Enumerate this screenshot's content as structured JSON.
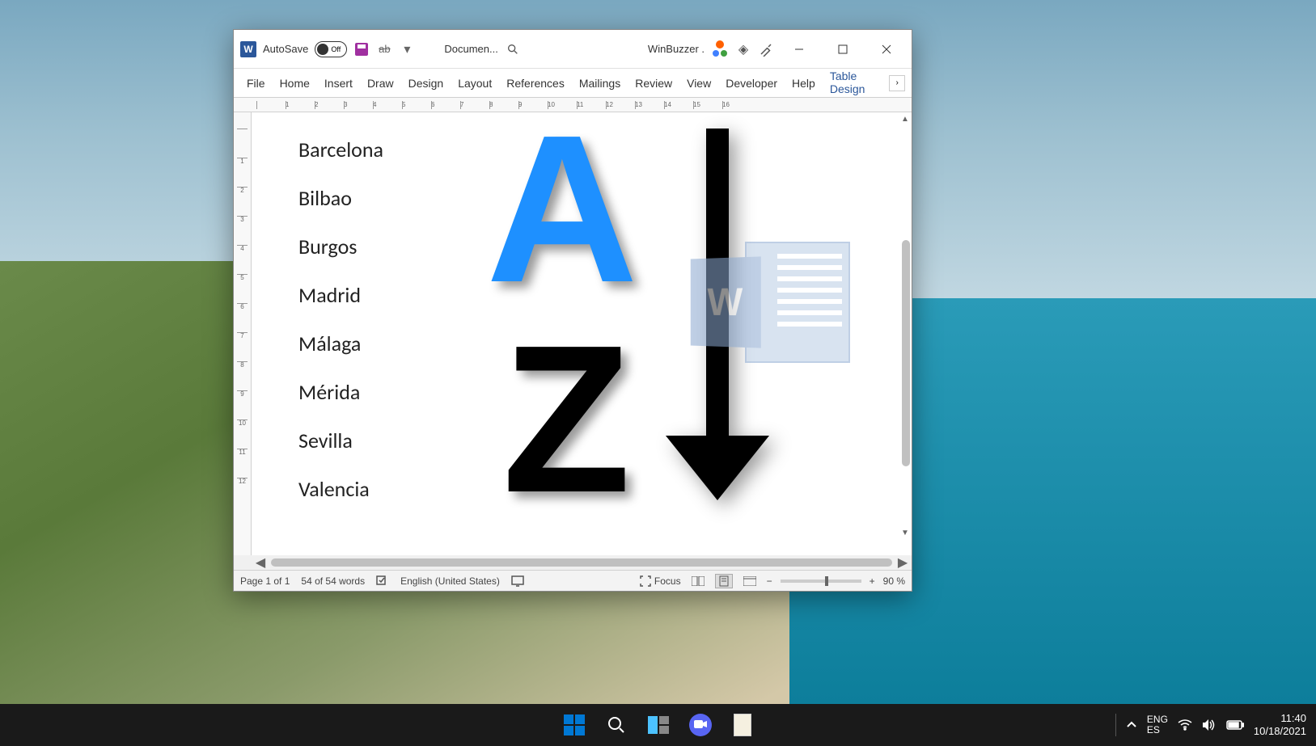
{
  "titlebar": {
    "autosave_label": "AutoSave",
    "autosave_state": "Off",
    "doc_title": "Documen...",
    "user_label": "WinBuzzer ."
  },
  "ribbon": {
    "tabs": [
      "File",
      "Home",
      "Insert",
      "Draw",
      "Design",
      "Layout",
      "References",
      "Mailings",
      "Review",
      "View",
      "Developer",
      "Help",
      "Table Design"
    ],
    "active_tab": "Table Design"
  },
  "ruler_h": [
    " ",
    "1",
    "2",
    "3",
    "4",
    "5",
    "6",
    "7",
    "8",
    "9",
    "10",
    "11",
    "12",
    "13",
    "14",
    "15",
    "16"
  ],
  "ruler_v": [
    " ",
    "1",
    "2",
    "3",
    "4",
    "5",
    "6",
    "7",
    "8",
    "9",
    "10",
    "11",
    "12"
  ],
  "document": {
    "cities": [
      "Barcelona",
      "Bilbao",
      "Burgos",
      "Madrid",
      "Málaga",
      "Mérida",
      "Sevilla",
      "Valencia"
    ],
    "graphic_a": "A",
    "graphic_z": "Z",
    "word_logo_letter": "W"
  },
  "statusbar": {
    "page": "Page 1 of 1",
    "words": "54 of 54 words",
    "language": "English (United States)",
    "focus": "Focus",
    "zoom_pct": "90 %",
    "zoom_minus": "−",
    "zoom_plus": "+"
  },
  "taskbar": {
    "lang1": "ENG",
    "lang2": "ES",
    "time": "11:40",
    "date": "10/18/2021"
  }
}
